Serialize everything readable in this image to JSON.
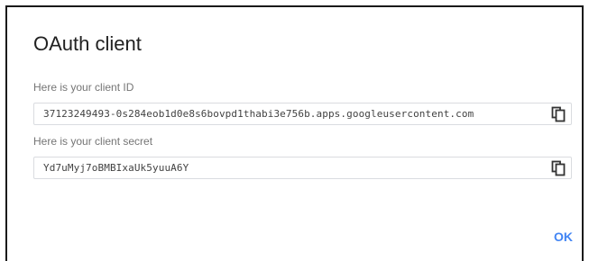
{
  "dialog": {
    "title": "OAuth client",
    "client_id": {
      "label": "Here is your client ID",
      "value": "37123249493-0s284eob1d0e8s6bovpd1thabi3e756b.apps.googleusercontent.com",
      "copy_icon": "copy-icon"
    },
    "client_secret": {
      "label": "Here is your client secret",
      "value": "Yd7uMyj7oBMBIxaUk5yuuA6Y",
      "copy_icon": "copy-icon"
    },
    "ok_label": "OK"
  },
  "colors": {
    "accent": "#4285f4",
    "label": "#757575",
    "title": "#212121",
    "border": "#dadce0"
  }
}
